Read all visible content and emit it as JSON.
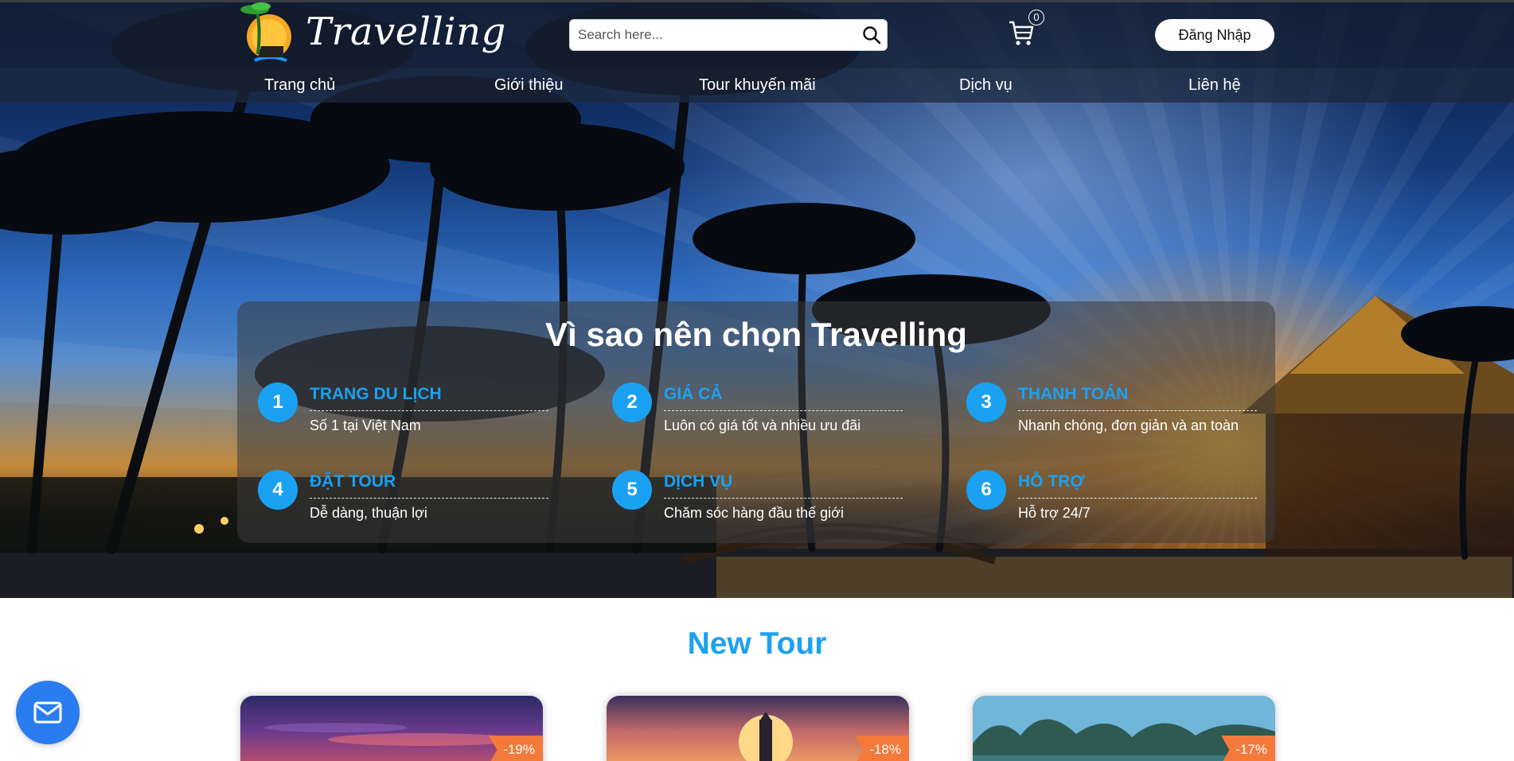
{
  "header": {
    "logo_text": "Travelling",
    "search": {
      "placeholder": "Search here...",
      "value": ""
    },
    "cart": {
      "count": "0",
      "icon": "cart-icon"
    },
    "login_label": "Đăng Nhập"
  },
  "nav": {
    "items": [
      {
        "label": "Trang chủ"
      },
      {
        "label": "Giới thiệu"
      },
      {
        "label": "Tour khuyến mãi"
      },
      {
        "label": "Dịch vụ"
      },
      {
        "label": "Liên hệ"
      }
    ]
  },
  "why": {
    "title": "Vì sao nên chọn Travelling",
    "features": [
      {
        "num": "1",
        "title": "TRANG DU LỊCH",
        "desc": "Số 1 tại Việt Nam"
      },
      {
        "num": "2",
        "title": "GIÁ CẢ",
        "desc": "Luôn có giá tốt và nhiều ưu đãi"
      },
      {
        "num": "3",
        "title": "THANH TOÁN",
        "desc": "Nhanh chóng, đơn giản và an toàn"
      },
      {
        "num": "4",
        "title": "ĐẶT TOUR",
        "desc": "Dễ dàng, thuận lợi"
      },
      {
        "num": "5",
        "title": "DỊCH VỤ",
        "desc": "Chăm sóc hàng đầu thế giới"
      },
      {
        "num": "6",
        "title": "HỖ TRỢ",
        "desc": "Hỗ trợ 24/7"
      }
    ]
  },
  "new_tour": {
    "title": "New Tour",
    "cards": [
      {
        "discount": "-19%"
      },
      {
        "discount": "-18%"
      },
      {
        "discount": "-17%"
      }
    ]
  },
  "colors": {
    "accent": "#1ba1f2",
    "discount": "#f37a3a",
    "mail_button": "#2a7df0"
  },
  "icons": {
    "search": "search-icon",
    "mail": "mail-icon"
  }
}
